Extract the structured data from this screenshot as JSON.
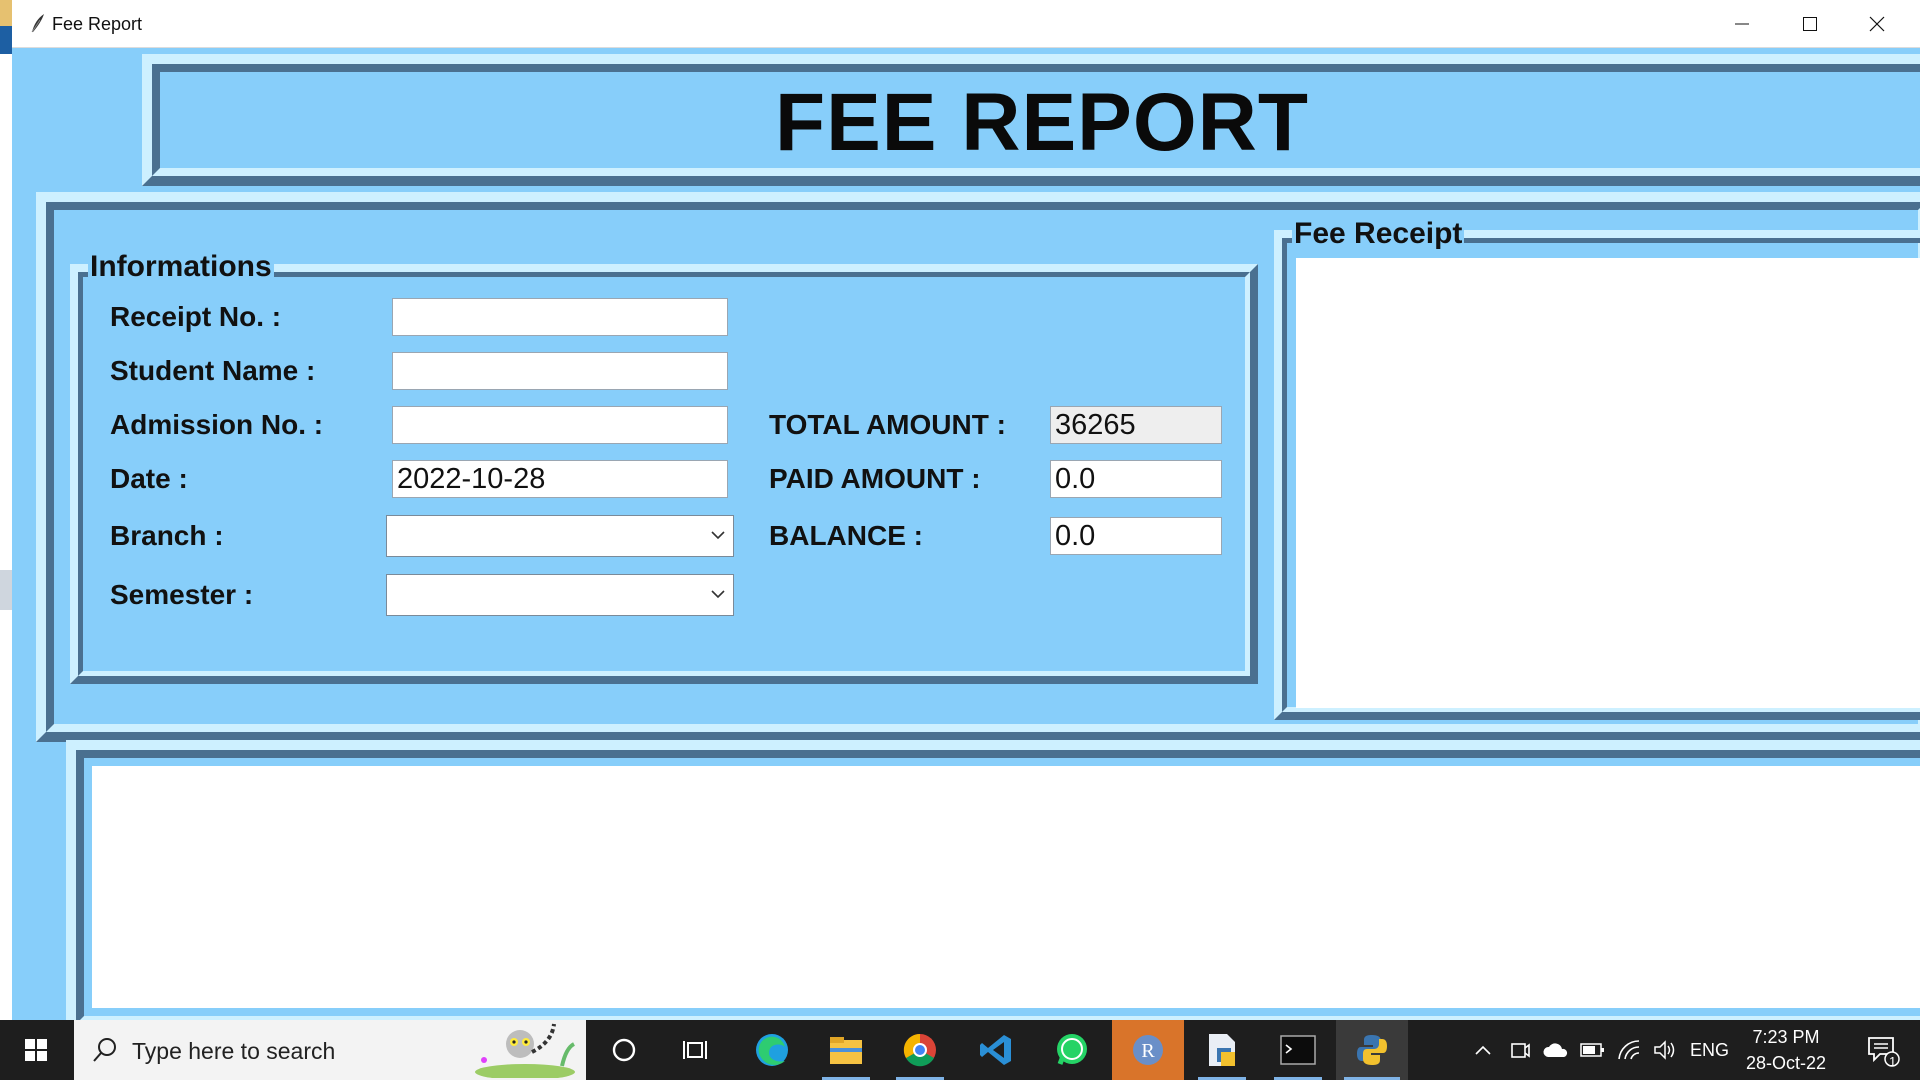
{
  "window": {
    "title": "Fee Report"
  },
  "header": {
    "title": "FEE REPORT"
  },
  "info": {
    "section_title": "Informations",
    "receipt_label": "Receipt No. :",
    "receipt_value": "",
    "student_label": "Student Name :",
    "student_value": "",
    "admission_label": "Admission No. :",
    "admission_value": "",
    "date_label": "Date :",
    "date_value": "2022-10-28",
    "branch_label": "Branch :",
    "branch_value": "",
    "semester_label": "Semester :",
    "semester_value": "",
    "total_label": "TOTAL AMOUNT :",
    "total_value": "36265",
    "paid_label": "PAID AMOUNT :",
    "paid_value": "0.0",
    "balance_label": "BALANCE :",
    "balance_value": "0.0"
  },
  "receipt": {
    "section_title": "Fee Receipt"
  },
  "taskbar": {
    "search_placeholder": "Type here to search",
    "time": "7:23 PM",
    "date": "28-Oct-22",
    "language": "ENG",
    "notification_count": "1"
  },
  "colors": {
    "background": "#87cefa",
    "shadow": "#4a7090",
    "highlight": "#cdf0ff"
  }
}
